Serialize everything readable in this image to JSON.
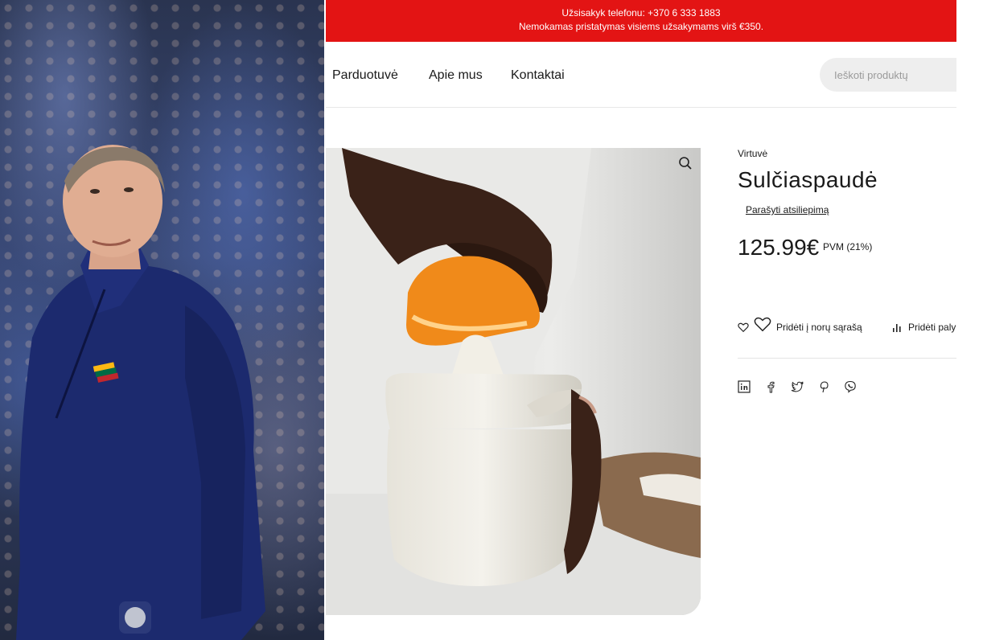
{
  "promo": {
    "line1": "Užsisakyk telefonu: +370 6 333 1883",
    "line2": "Nemokamas pristatymas visiems užsakymams virš €350."
  },
  "nav": {
    "items": [
      "Parduotuvė",
      "Apie mus",
      "Kontaktai"
    ],
    "search_placeholder": "Ieškoti produktų"
  },
  "product": {
    "category": "Virtuvė",
    "title": "Sulčiaspaudė",
    "review_link": "Parašyti atsiliepimą",
    "price": "125.99€",
    "vat": "PVM (21%)",
    "wishlist_label": "Pridėti į norų sąrašą",
    "compare_label": "Pridėti paly"
  },
  "icons": {
    "zoom": "magnifier-icon",
    "wishlist": "heart-icon",
    "compare": "bar-chart-icon",
    "social": [
      "linkedin-icon",
      "facebook-icon",
      "twitter-icon",
      "pinterest-icon",
      "viber-icon"
    ]
  },
  "colors": {
    "promo_bg": "#e31414",
    "text": "#1a1a1a",
    "search_bg": "#eeeeee"
  }
}
